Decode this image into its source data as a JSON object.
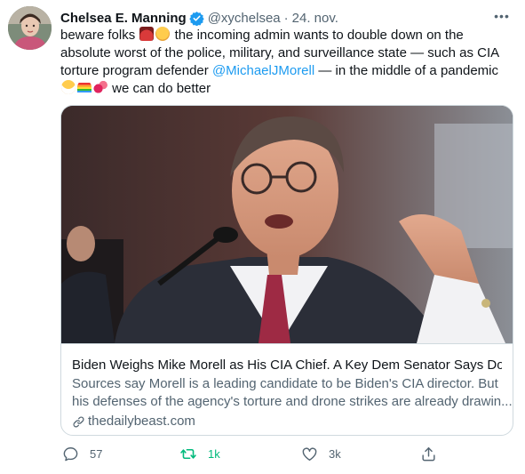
{
  "tweet": {
    "author_name": "Chelsea E. Manning",
    "author_handle": "@xychelsea",
    "separator": "·",
    "date": "24. nov.",
    "more_label": "•••",
    "text_line1_a": "beware folks",
    "text_line1_b": "the incoming admin wants to double down on the",
    "text_line2": "absolute worst of the police, military, and surveillance state — such as CIA",
    "text_line3_a": "torture program defender",
    "text_line3_mention": "@MichaelJMorell",
    "text_line3_b": "— in the middle of a pandemic",
    "text_line4": "we can do better"
  },
  "card": {
    "title": "Biden Weighs Mike Morell as His CIA Chief. A Key Dem Senator Says Do...",
    "description_line1": "Sources say Morell is a leading candidate to be Biden's CIA director. But",
    "description_line2": "his defenses of the agency's torture and drone strikes are already drawin...",
    "domain": "thedailybeast.com"
  },
  "actions": {
    "reply_count": "57",
    "retweet_count": "1k",
    "like_count": "3k"
  },
  "colors": {
    "accent": "#1d9bf0",
    "retweet_active": "#00ba7c",
    "secondary_text": "#536471",
    "border": "#cfd9de"
  },
  "icons": {
    "verified": "verified-badge-icon",
    "more": "more-icon",
    "link": "link-icon",
    "reply": "reply-icon",
    "retweet": "retweet-icon",
    "like": "heart-icon",
    "share": "share-icon"
  }
}
